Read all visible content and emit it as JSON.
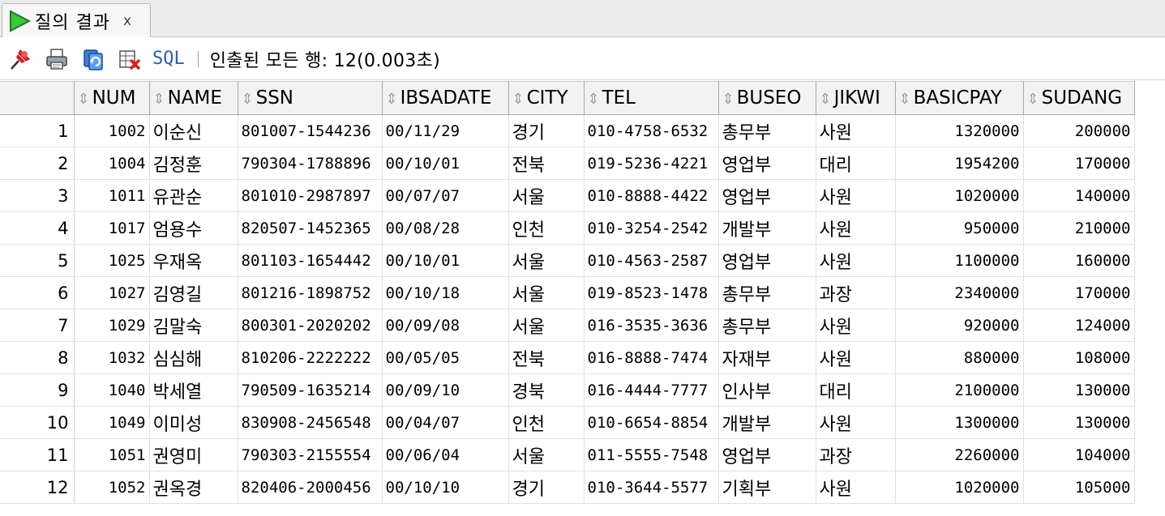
{
  "tab": {
    "label": "질의 결과",
    "close": "x"
  },
  "toolbar": {
    "sql_label": "SQL",
    "separator": "|",
    "status": "인출된 모든 행: 12(0.003초)"
  },
  "grid": {
    "columns": [
      {
        "label": "NUM",
        "align": "num"
      },
      {
        "label": "NAME",
        "align": "kr"
      },
      {
        "label": "SSN",
        "align": "mono"
      },
      {
        "label": "IBSADATE",
        "align": "mono"
      },
      {
        "label": "CITY",
        "align": "kr"
      },
      {
        "label": "TEL",
        "align": "mono"
      },
      {
        "label": "BUSEO",
        "align": "kr"
      },
      {
        "label": "JIKWI",
        "align": "kr"
      },
      {
        "label": "BASICPAY",
        "align": "num"
      },
      {
        "label": "SUDANG",
        "align": "num"
      }
    ],
    "rows": [
      [
        "1",
        "1002",
        "이순신",
        "801007-1544236",
        "00/11/29",
        "경기",
        "010-4758-6532",
        "총무부",
        "사원",
        "1320000",
        "200000"
      ],
      [
        "2",
        "1004",
        "김정훈",
        "790304-1788896",
        "00/10/01",
        "전북",
        "019-5236-4221",
        "영업부",
        "대리",
        "1954200",
        "170000"
      ],
      [
        "3",
        "1011",
        "유관순",
        "801010-2987897",
        "00/07/07",
        "서울",
        "010-8888-4422",
        "영업부",
        "사원",
        "1020000",
        "140000"
      ],
      [
        "4",
        "1017",
        "엄용수",
        "820507-1452365",
        "00/08/28",
        "인천",
        "010-3254-2542",
        "개발부",
        "사원",
        "950000",
        "210000"
      ],
      [
        "5",
        "1025",
        "우재옥",
        "801103-1654442",
        "00/10/01",
        "서울",
        "010-4563-2587",
        "영업부",
        "사원",
        "1100000",
        "160000"
      ],
      [
        "6",
        "1027",
        "김영길",
        "801216-1898752",
        "00/10/18",
        "서울",
        "019-8523-1478",
        "총무부",
        "과장",
        "2340000",
        "170000"
      ],
      [
        "7",
        "1029",
        "김말숙",
        "800301-2020202",
        "00/09/08",
        "서울",
        "016-3535-3636",
        "총무부",
        "사원",
        "920000",
        "124000"
      ],
      [
        "8",
        "1032",
        "심심해",
        "810206-2222222",
        "00/05/05",
        "전북",
        "016-8888-7474",
        "자재부",
        "사원",
        "880000",
        "108000"
      ],
      [
        "9",
        "1040",
        "박세열",
        "790509-1635214",
        "00/09/10",
        "경북",
        "016-4444-7777",
        "인사부",
        "대리",
        "2100000",
        "130000"
      ],
      [
        "10",
        "1049",
        "이미성",
        "830908-2456548",
        "00/04/07",
        "인천",
        "010-6654-8854",
        "개발부",
        "사원",
        "1300000",
        "130000"
      ],
      [
        "11",
        "1051",
        "권영미",
        "790303-2155554",
        "00/06/04",
        "서울",
        "011-5555-7548",
        "영업부",
        "과장",
        "2260000",
        "104000"
      ],
      [
        "12",
        "1052",
        "권옥경",
        "820406-2000456",
        "00/10/10",
        "경기",
        "010-3644-5577",
        "기획부",
        "사원",
        "1020000",
        "105000"
      ]
    ]
  },
  "icons": {
    "tab": "play-icon",
    "toolbar": [
      "pin-icon",
      "print-icon",
      "refresh-icon",
      "clear-icon"
    ]
  },
  "colors": {
    "sql_link": "#2a5db0",
    "play_icon": "#2bb52b"
  }
}
